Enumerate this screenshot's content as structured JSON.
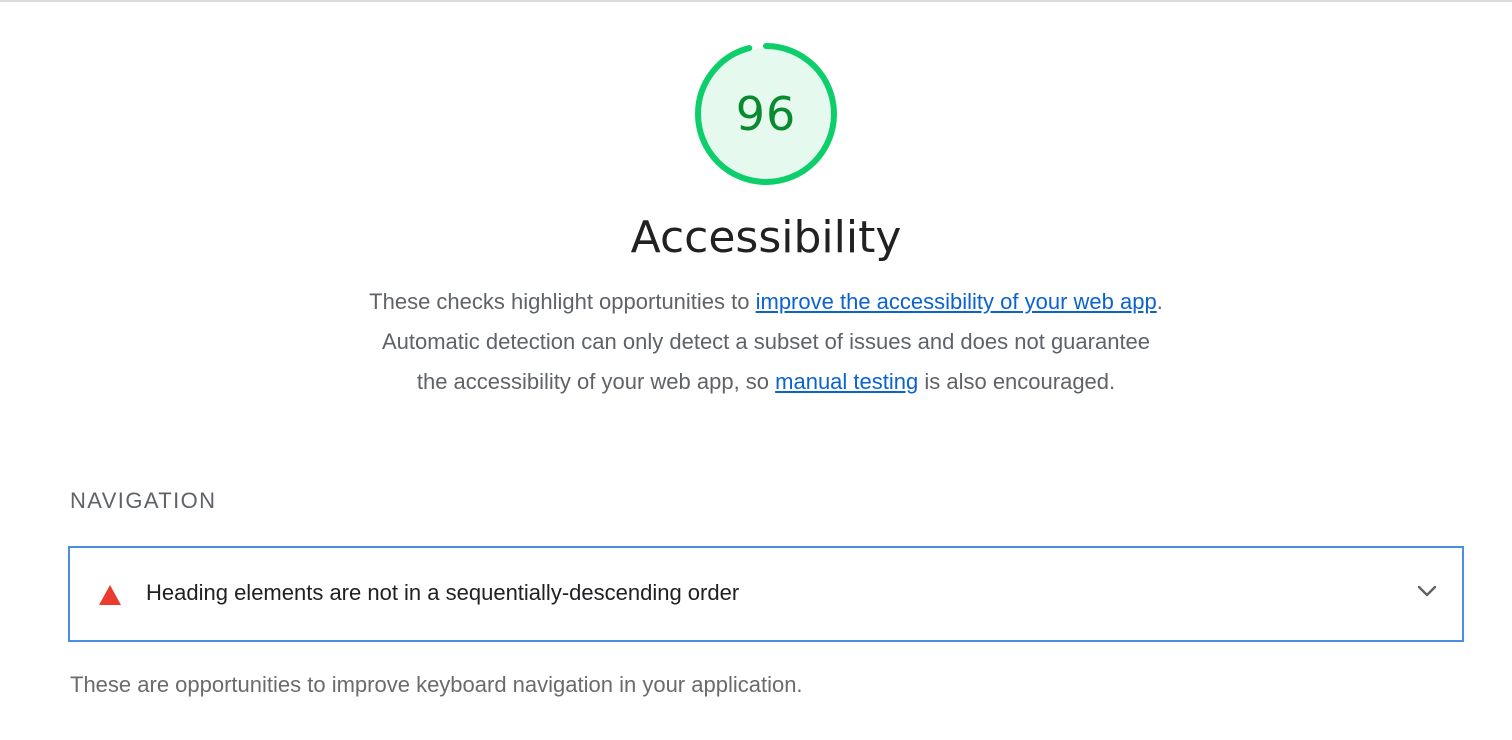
{
  "score": {
    "value": "96",
    "fraction": 0.96,
    "ring_color": "#0cce6b",
    "fill_color": "#e6f9ee",
    "text_color": "#0a8a2f"
  },
  "category": {
    "title": "Accessibility"
  },
  "description": {
    "part1": "These checks highlight opportunities to ",
    "link1": "improve the accessibility of your web app",
    "part2": ". Automatic detection can only detect a subset of issues and does not guarantee the accessibility of your web app, so ",
    "link2": "manual testing",
    "part3": " is also encouraged."
  },
  "group": {
    "title": "NAVIGATION",
    "description": "These are opportunities to improve keyboard navigation in your application."
  },
  "audits": [
    {
      "title": "Heading elements are not in a sequentially-descending order",
      "status_icon": "fail-triangle-icon",
      "status_color": "#eb3b2f"
    }
  ],
  "icons": {
    "expand": "chevron-down-icon"
  }
}
